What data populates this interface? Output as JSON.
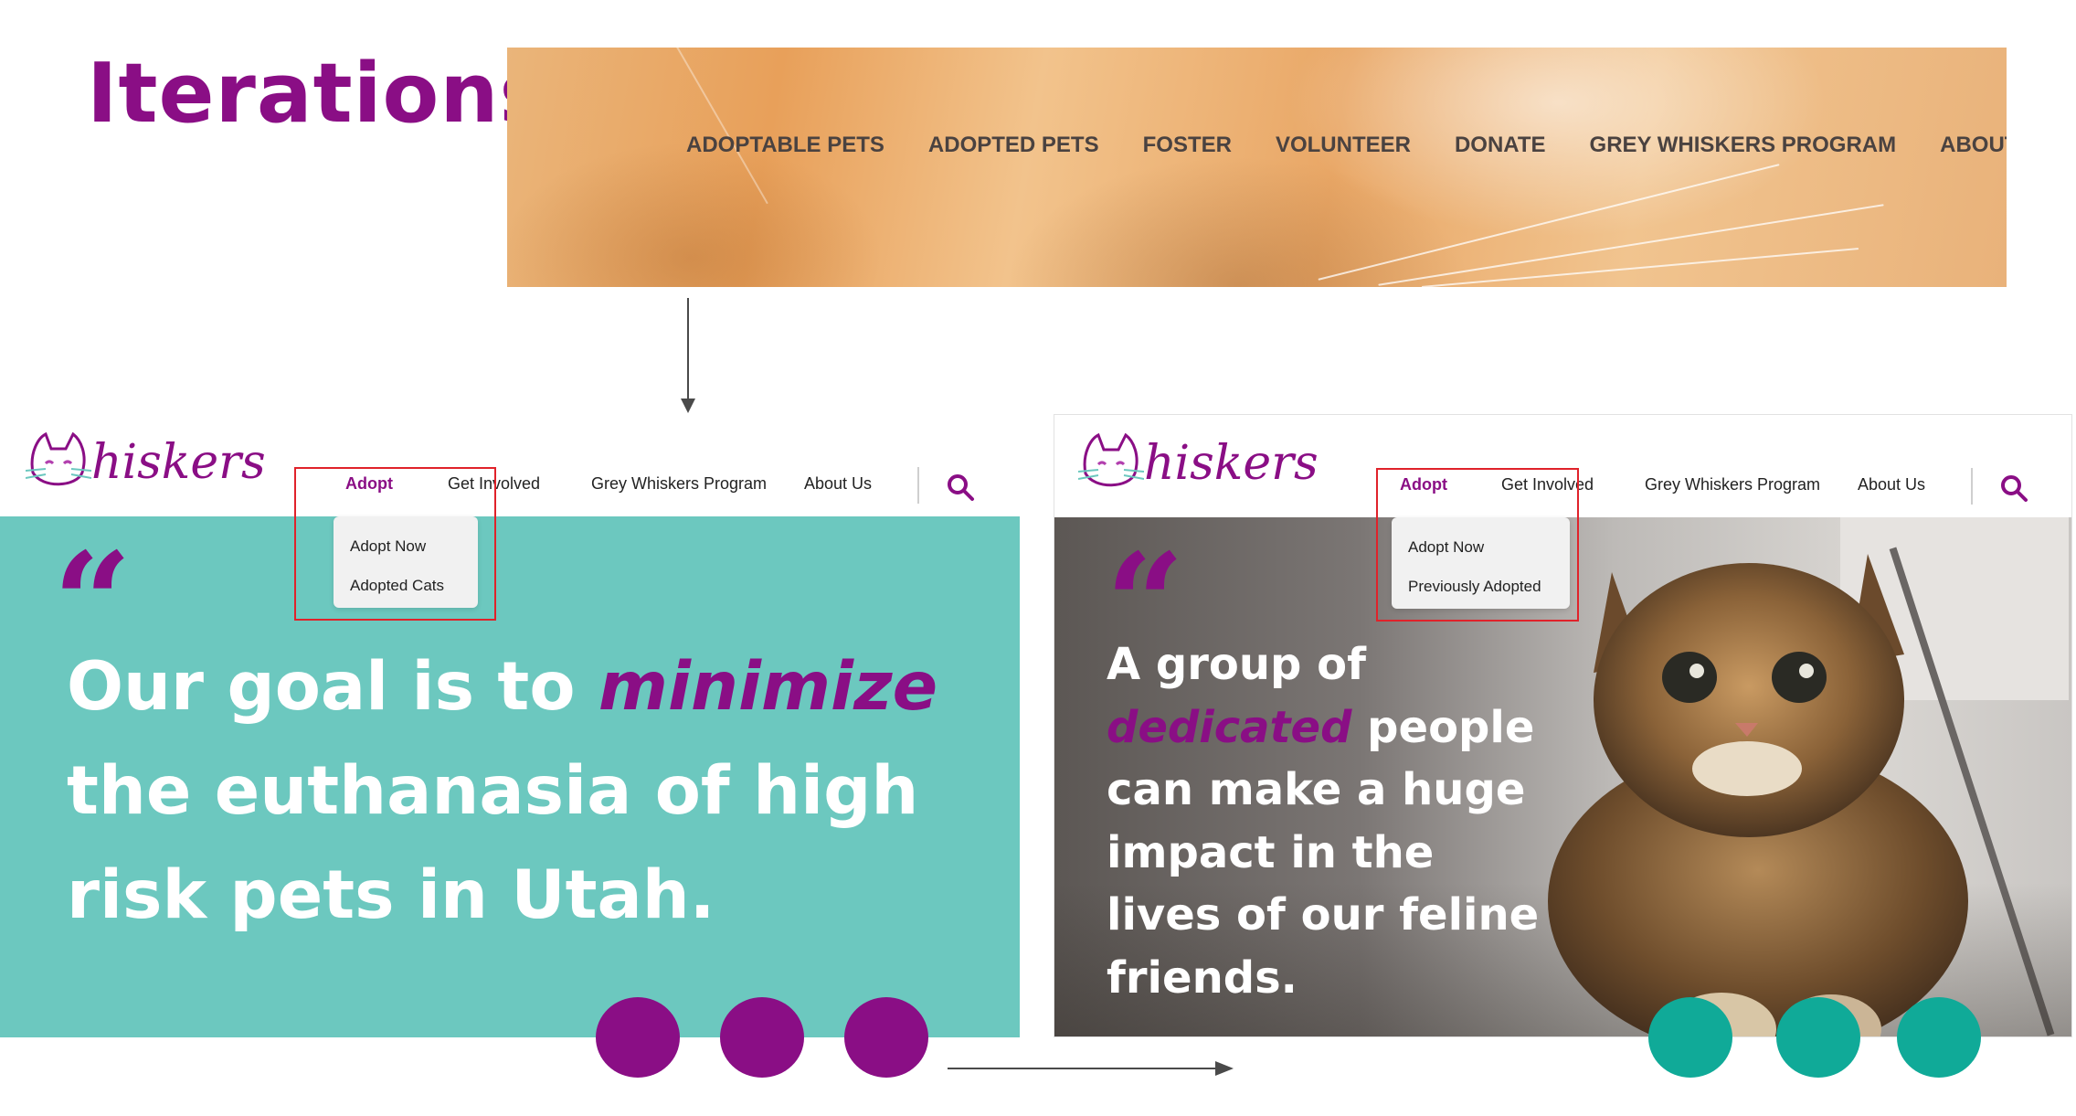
{
  "page": {
    "title": "Iterations"
  },
  "colors": {
    "brand_purple": "#8a0e85",
    "teal_panel": "#6cc8bf",
    "teal_dot": "#10aa98",
    "highlight_red": "#e0222a"
  },
  "old_header": {
    "nav_items": [
      "ADOPTABLE PETS",
      "ADOPTED PETS",
      "FOSTER",
      "VOLUNTEER",
      "DONATE",
      "GREY WHISKERS PROGRAM",
      "ABOUT US"
    ]
  },
  "left_mock": {
    "logo_text": "hiskers",
    "nav": {
      "adopt": "Adopt",
      "get_involved": "Get Involved",
      "grey_whiskers": "Grey Whiskers Program",
      "about_us": "About Us"
    },
    "dropdown": [
      "Adopt Now",
      "Adopted Cats"
    ],
    "quote_mark": "“",
    "hero": {
      "part1": "Our goal is to ",
      "emphasis": "minimize",
      "part2": " the euthanasia of high risk pets in Utah."
    }
  },
  "right_mock": {
    "logo_text": "hiskers",
    "nav": {
      "adopt": "Adopt",
      "get_involved": "Get Involved",
      "grey_whiskers": "Grey Whiskers Program",
      "about_us": "About Us"
    },
    "dropdown": [
      "Adopt Now",
      "Previously Adopted"
    ],
    "quote_mark": "“",
    "hero": {
      "part1": "A group of ",
      "emphasis": "dedicated",
      "part2": " people can make a huge impact in the lives of our feline friends."
    }
  },
  "icons": {
    "search": "search-icon",
    "logo_cat": "cat-face-logo-icon"
  }
}
